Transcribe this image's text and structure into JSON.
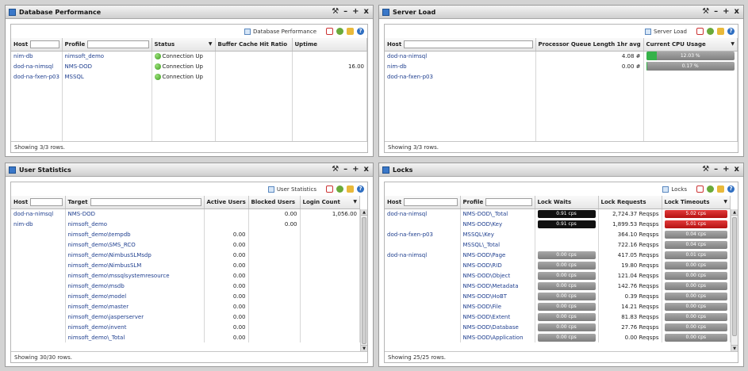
{
  "db": {
    "title": "Database Performance",
    "toolbar_label": "Database Performance",
    "columns": [
      "Host",
      "Profile",
      "Status",
      "Buffer Cache Hit Ratio",
      "Uptime"
    ],
    "rows": [
      {
        "host": "nim-db",
        "profile": "nimsoft_demo",
        "status": "Connection Up",
        "ratio": "",
        "uptime": ""
      },
      {
        "host": "dod-na-nimsql",
        "profile": "NMS-DOD",
        "status": "Connection Up",
        "ratio": "",
        "uptime": "16.00"
      },
      {
        "host": "dod-na-fxen-p03",
        "profile": "MSSQL",
        "status": "Connection Up",
        "ratio": "",
        "uptime": ""
      }
    ],
    "footer": "Showing 3/3 rows."
  },
  "server": {
    "title": "Server Load",
    "toolbar_label": "Server Load",
    "columns": [
      "Host",
      "Processor Queue Length 1hr avg",
      "Current CPU Usage"
    ],
    "rows": [
      {
        "host": "dod-na-nimsql",
        "queue": "4.08 #",
        "cpu": "12.03 %",
        "cpu_value": 12.03
      },
      {
        "host": "nim-db",
        "queue": "0.00 #",
        "cpu": "0.17 %",
        "cpu_value": 0.17
      },
      {
        "host": "dod-na-fxen-p03",
        "queue": "",
        "cpu": "",
        "cpu_value": null
      }
    ],
    "footer": "Showing 3/3 rows."
  },
  "users": {
    "title": "User Statistics",
    "toolbar_label": "User Statistics",
    "columns": [
      "Host",
      "Target",
      "Active Users",
      "Blocked Users",
      "Login Count"
    ],
    "rows": [
      {
        "host": "dod-na-nimsql",
        "target": "NMS-DOD",
        "active": "",
        "blocked": "0.00",
        "login": "1,056.00"
      },
      {
        "host": "nim-db",
        "target": "nimsoft_demo",
        "active": "",
        "blocked": "0.00",
        "login": ""
      },
      {
        "host": "",
        "target": "nimsoft_demo\\tempdb",
        "active": "0.00",
        "blocked": "",
        "login": ""
      },
      {
        "host": "",
        "target": "nimsoft_demo\\SMS_RCO",
        "active": "0.00",
        "blocked": "",
        "login": ""
      },
      {
        "host": "",
        "target": "nimsoft_demo\\NimbusSLMsdp",
        "active": "0.00",
        "blocked": "",
        "login": ""
      },
      {
        "host": "",
        "target": "nimsoft_demo\\NimbusSLM",
        "active": "0.00",
        "blocked": "",
        "login": ""
      },
      {
        "host": "",
        "target": "nimsoft_demo\\mssqlsystemresource",
        "active": "0.00",
        "blocked": "",
        "login": ""
      },
      {
        "host": "",
        "target": "nimsoft_demo\\msdb",
        "active": "0.00",
        "blocked": "",
        "login": ""
      },
      {
        "host": "",
        "target": "nimsoft_demo\\model",
        "active": "0.00",
        "blocked": "",
        "login": ""
      },
      {
        "host": "",
        "target": "nimsoft_demo\\master",
        "active": "0.00",
        "blocked": "",
        "login": ""
      },
      {
        "host": "",
        "target": "nimsoft_demo\\jasperserver",
        "active": "0.00",
        "blocked": "",
        "login": ""
      },
      {
        "host": "",
        "target": "nimsoft_demo\\invent",
        "active": "0.00",
        "blocked": "",
        "login": ""
      },
      {
        "host": "",
        "target": "nimsoft_demo\\_Total",
        "active": "0.00",
        "blocked": "",
        "login": ""
      }
    ],
    "footer": "Showing 30/30 rows."
  },
  "locks": {
    "title": "Locks",
    "toolbar_label": "Locks",
    "columns": [
      "Host",
      "Profile",
      "Lock Waits",
      "Lock Requests",
      "Lock Timeouts"
    ],
    "rows": [
      {
        "host": "dod-na-nimsql",
        "profile": "NMS-DOD\\_Total",
        "waits": "0.91 cps",
        "waits_style": "black",
        "req": "2,724.37 Reqsps",
        "to": "5.02 cps",
        "to_style": "red"
      },
      {
        "host": "",
        "profile": "NMS-DOD\\Key",
        "waits": "0.91 cps",
        "waits_style": "black",
        "req": "1,899.53 Reqsps",
        "to": "5.01 cps",
        "to_style": "red"
      },
      {
        "host": "dod-na-fxen-p03",
        "profile": "MSSQL\\Key",
        "waits": "",
        "waits_style": "none",
        "req": "364.10 Reqsps",
        "to": "0.04 cps",
        "to_style": "gray"
      },
      {
        "host": "",
        "profile": "MSSQL\\_Total",
        "waits": "",
        "waits_style": "none",
        "req": "722.16 Reqsps",
        "to": "0.04 cps",
        "to_style": "gray"
      },
      {
        "host": "dod-na-nimsql",
        "profile": "NMS-DOD\\Page",
        "waits": "0.00 cps",
        "waits_style": "gray",
        "req": "417.05 Reqsps",
        "to": "0.01 cps",
        "to_style": "gray"
      },
      {
        "host": "",
        "profile": "NMS-DOD\\RID",
        "waits": "0.00 cps",
        "waits_style": "gray",
        "req": "19.80 Reqsps",
        "to": "0.00 cps",
        "to_style": "gray"
      },
      {
        "host": "",
        "profile": "NMS-DOD\\Object",
        "waits": "0.00 cps",
        "waits_style": "gray",
        "req": "121.04 Reqsps",
        "to": "0.00 cps",
        "to_style": "gray"
      },
      {
        "host": "",
        "profile": "NMS-DOD\\Metadata",
        "waits": "0.00 cps",
        "waits_style": "gray",
        "req": "142.76 Reqsps",
        "to": "0.00 cps",
        "to_style": "gray"
      },
      {
        "host": "",
        "profile": "NMS-DOD\\HoBT",
        "waits": "0.00 cps",
        "waits_style": "gray",
        "req": "0.39 Reqsps",
        "to": "0.00 cps",
        "to_style": "gray"
      },
      {
        "host": "",
        "profile": "NMS-DOD\\File",
        "waits": "0.00 cps",
        "waits_style": "gray",
        "req": "14.21 Reqsps",
        "to": "0.00 cps",
        "to_style": "gray"
      },
      {
        "host": "",
        "profile": "NMS-DOD\\Extent",
        "waits": "0.00 cps",
        "waits_style": "gray",
        "req": "81.83 Reqsps",
        "to": "0.00 cps",
        "to_style": "gray"
      },
      {
        "host": "",
        "profile": "NMS-DOD\\Database",
        "waits": "0.00 cps",
        "waits_style": "gray",
        "req": "27.76 Reqsps",
        "to": "0.00 cps",
        "to_style": "gray"
      },
      {
        "host": "",
        "profile": "NMS-DOD\\Application",
        "waits": "0.00 cps",
        "waits_style": "gray",
        "req": "0.00 Reqsps",
        "to": "0.00 cps",
        "to_style": "gray"
      }
    ],
    "footer": "Showing 25/25 rows."
  },
  "controls": {
    "settings": "⚙",
    "minimize": "–",
    "maximize": "+",
    "close": "x",
    "wrench": "🔧"
  },
  "icons": {
    "help": "?"
  }
}
